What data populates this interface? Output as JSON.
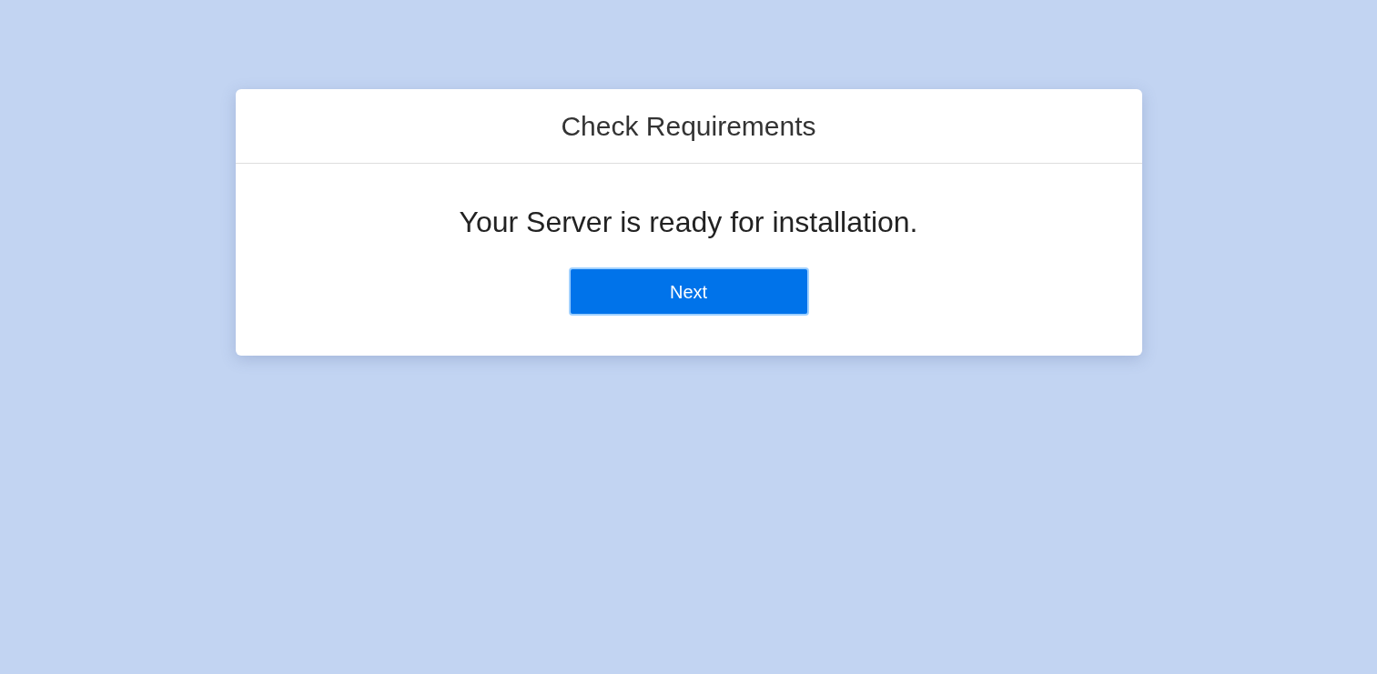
{
  "card": {
    "title": "Check Requirements",
    "message": "Your Server is ready for installation.",
    "button": {
      "label": "Next",
      "focused": true
    }
  }
}
